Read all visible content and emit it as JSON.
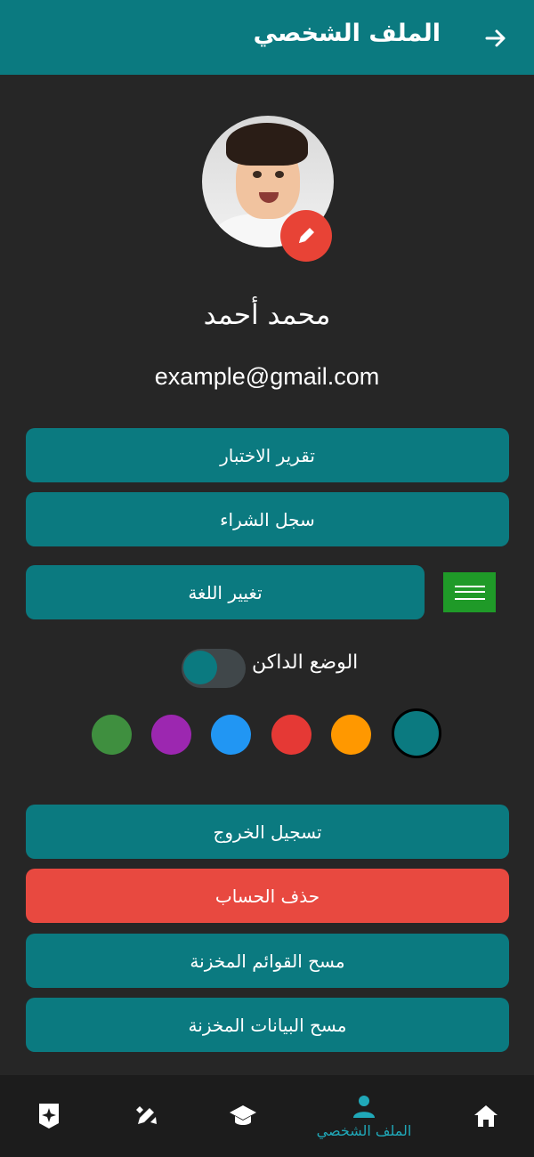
{
  "header": {
    "title": "الملف الشخصي"
  },
  "profile": {
    "name": "محمد أحمد",
    "email": "example@gmail.com"
  },
  "buttons": {
    "test_report": "تقرير الاختبار",
    "purchase_history": "سجل الشراء",
    "change_language": "تغيير اللغة",
    "logout": "تسجيل الخروج",
    "delete_account": "حذف الحساب",
    "clear_lists": "مسح القوائم المخزنة",
    "clear_data": "مسح البيانات المخزنة"
  },
  "settings": {
    "dark_mode_label": "الوضع الداكن",
    "dark_mode_on": true
  },
  "theme_colors": [
    "#3f8f3f",
    "#9c27b0",
    "#2196f3",
    "#e53935",
    "#ff9800",
    "#0b7a80"
  ],
  "selected_theme": "#0b7a80",
  "nav": {
    "items": [
      {
        "icon": "home-icon"
      },
      {
        "icon": "profile-icon",
        "label": "الملف الشخصي"
      },
      {
        "icon": "graduation-cap-icon"
      },
      {
        "icon": "pen-icon"
      },
      {
        "icon": "sparkle-icon"
      }
    ]
  },
  "colors": {
    "accent": "#0b7a80",
    "danger": "#e84940",
    "background": "#262626"
  }
}
